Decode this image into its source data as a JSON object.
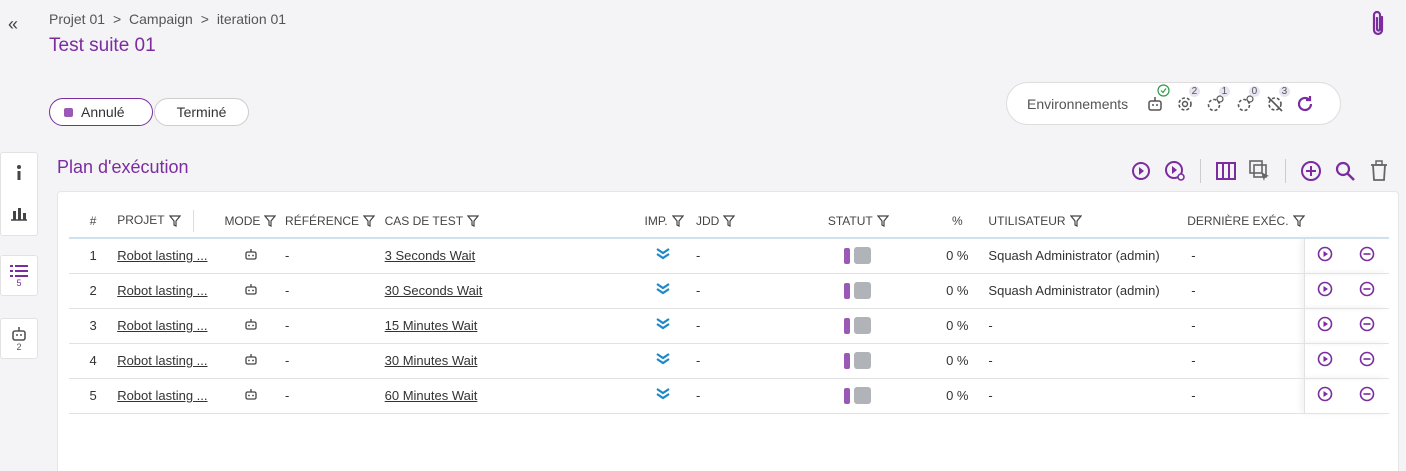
{
  "breadcrumb": [
    "Projet 01",
    ">",
    "Campaign",
    ">",
    "iteration 01"
  ],
  "title": "Test suite 01",
  "status_pills": {
    "cancelled": "Annulé",
    "done": "Terminé"
  },
  "environments": {
    "label": "Environnements",
    "counts": [
      "2",
      "1",
      "0",
      "3"
    ]
  },
  "section_title": "Plan d'exécution",
  "rail": {
    "list_count": "5",
    "robot_count": "2"
  },
  "columns": [
    "#",
    "PROJET",
    "MODE",
    "RÉFÉRENCE",
    "CAS DE TEST",
    "IMP.",
    "JDD",
    "STATUT",
    "%",
    "UTILISATEUR",
    "DERNIÈRE EXÉC."
  ],
  "rows": [
    {
      "num": "1",
      "projet": "Robot lasting ...",
      "ref": "-",
      "cas": "3 Seconds Wait",
      "jdd": "-",
      "pct": "0 %",
      "user": "Squash Administrator (admin)",
      "last": "-"
    },
    {
      "num": "2",
      "projet": "Robot lasting ...",
      "ref": "-",
      "cas": "30 Seconds Wait",
      "jdd": "-",
      "pct": "0 %",
      "user": "Squash Administrator (admin)",
      "last": "-"
    },
    {
      "num": "3",
      "projet": "Robot lasting ...",
      "ref": "-",
      "cas": "15 Minutes Wait",
      "jdd": "-",
      "pct": "0 %",
      "user": "-",
      "last": "-"
    },
    {
      "num": "4",
      "projet": "Robot lasting ...",
      "ref": "-",
      "cas": "30 Minutes Wait",
      "jdd": "-",
      "pct": "0 %",
      "user": "-",
      "last": "-"
    },
    {
      "num": "5",
      "projet": "Robot lasting ...",
      "ref": "-",
      "cas": "60 Minutes Wait",
      "jdd": "-",
      "pct": "0 %",
      "user": "-",
      "last": "-"
    }
  ],
  "colors": {
    "accent": "#7b2c9f",
    "importance": "#1e88c8"
  }
}
